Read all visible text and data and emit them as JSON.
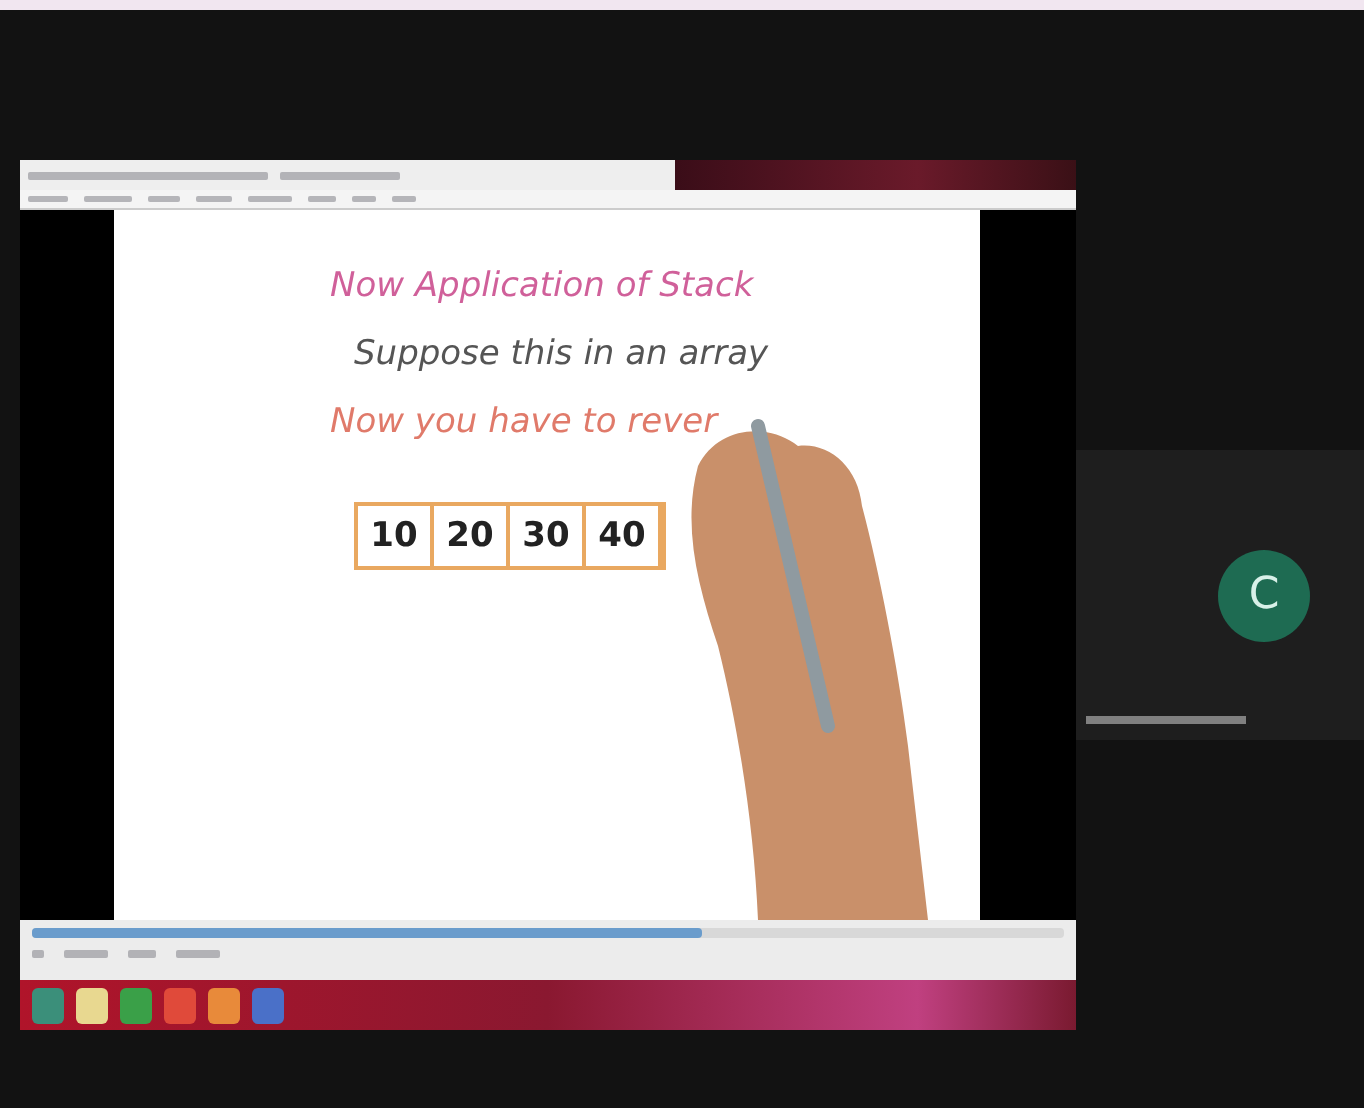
{
  "shared_screen": {
    "slide": {
      "lines": [
        {
          "text": "Now Application of Stack",
          "kind": "title"
        },
        {
          "text": "Suppose this in an array",
          "kind": "body"
        },
        {
          "text": "Now you have to rever",
          "kind": "accent"
        }
      ],
      "array_cells": [
        "10",
        "20",
        "30",
        "40"
      ]
    },
    "player": {
      "level": 0.65
    }
  },
  "participant": {
    "avatar_letter": "C"
  }
}
